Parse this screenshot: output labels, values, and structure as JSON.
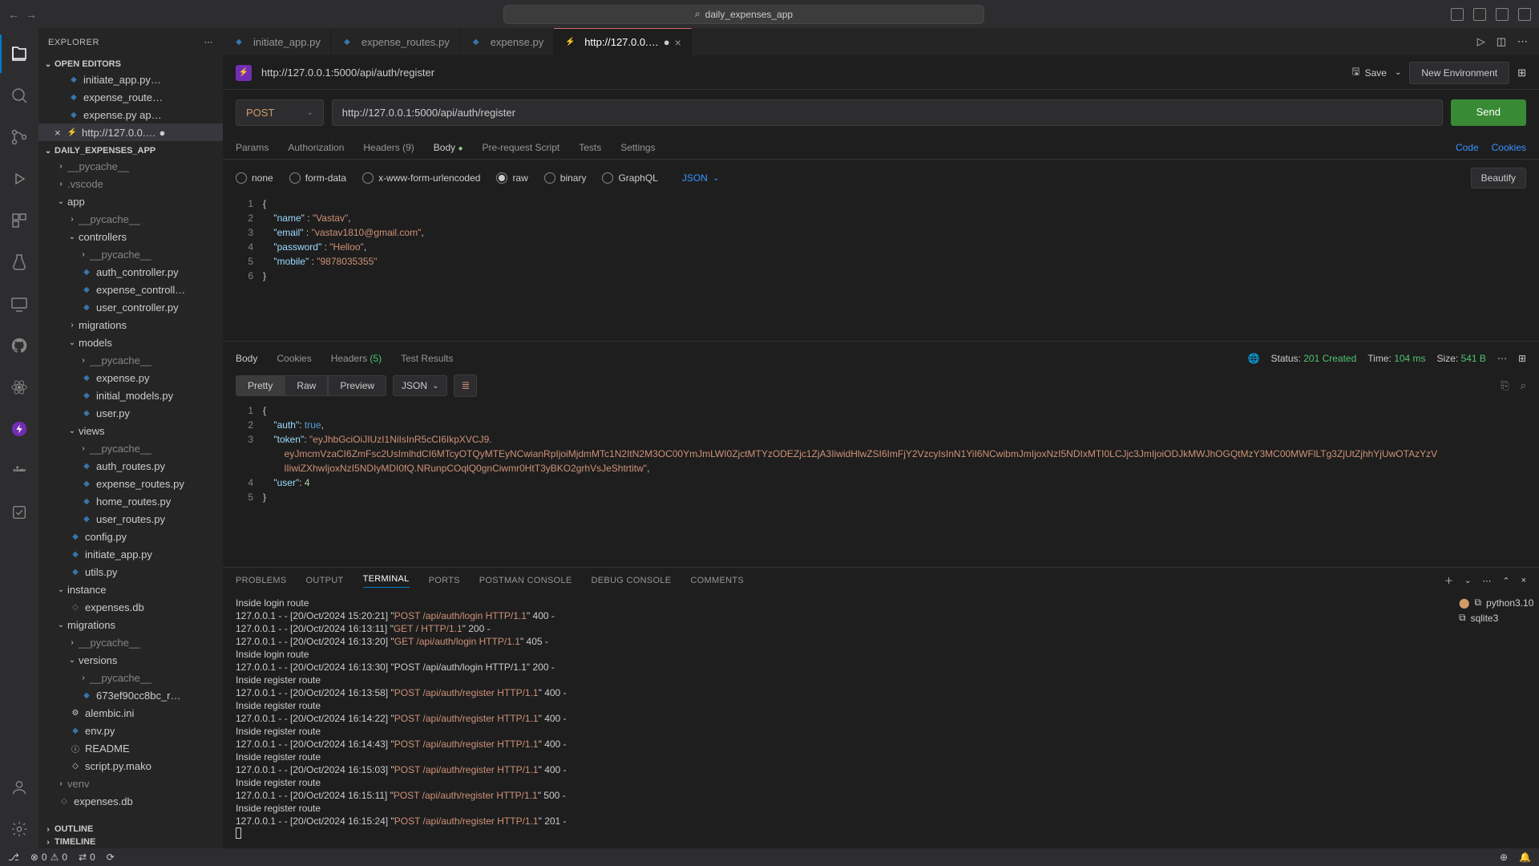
{
  "titlebar": {
    "search_text": "daily_expenses_app"
  },
  "sidebar": {
    "title": "EXPLORER",
    "sections": {
      "open_editors": "OPEN EDITORS",
      "project": "DAILY_EXPENSES_APP",
      "outline": "OUTLINE",
      "timeline": "TIMELINE"
    },
    "open_editors": [
      "initiate_app.py…",
      "expense_route…",
      "expense.py ap…",
      "http://127.0.0.…"
    ],
    "tree": {
      "pycache0": "__pycache__",
      "vscode": ".vscode",
      "app": "app",
      "pycache1": "__pycache__",
      "controllers": "controllers",
      "pycache2": "__pycache__",
      "auth_ctrl": "auth_controller.py",
      "expense_ctrl": "expense_controll…",
      "user_ctrl": "user_controller.py",
      "migrations": "migrations",
      "models": "models",
      "pycache3": "__pycache__",
      "expense": "expense.py",
      "initial_models": "initial_models.py",
      "user": "user.py",
      "views": "views",
      "pycache4": "__pycache__",
      "auth_routes": "auth_routes.py",
      "expense_routes": "expense_routes.py",
      "home_routes": "home_routes.py",
      "user_routes": "user_routes.py",
      "config": "config.py",
      "initiate": "initiate_app.py",
      "utils": "utils.py",
      "instance": "instance",
      "expenses_db": "expenses.db",
      "migrations2": "migrations",
      "pycache5": "__pycache__",
      "versions": "versions",
      "pycache6": "__pycache__",
      "673ef": "673ef90cc8bc_r…",
      "alembic": "alembic.ini",
      "env": "env.py",
      "readme": "README",
      "mako": "script.py.mako",
      "venv": "venv",
      "expenses_db2": "expenses.db"
    }
  },
  "tabs": [
    {
      "label": "initiate_app.py",
      "type": "py",
      "active": false
    },
    {
      "label": "expense_routes.py",
      "type": "py",
      "active": false
    },
    {
      "label": "expense.py",
      "type": "py",
      "active": false
    },
    {
      "label": "http://127.0.0.…",
      "type": "tc",
      "active": true
    }
  ],
  "tc": {
    "url_label": "http://127.0.0.1:5000/api/auth/register",
    "method": "POST",
    "url": "http://127.0.0.1:5000/api/auth/register",
    "send": "Send",
    "save": "Save",
    "new_env": "New Environment",
    "req_tabs": {
      "params": "Params",
      "auth": "Authorization",
      "headers": "Headers",
      "headers_count": "(9)",
      "body": "Body",
      "prescript": "Pre-request Script",
      "tests": "Tests",
      "settings": "Settings",
      "code": "Code",
      "cookies": "Cookies"
    },
    "body_types": {
      "none": "none",
      "form": "form-data",
      "xwww": "x-www-form-urlencoded",
      "raw": "raw",
      "binary": "binary",
      "graphql": "GraphQL"
    },
    "json_label": "JSON",
    "beautify": "Beautify",
    "request_body": {
      "keys": {
        "name": "\"name\"",
        "email": "\"email\"",
        "password": "\"password\"",
        "mobile": "\"mobile\""
      },
      "vals": {
        "name": "\"Vastav\"",
        "email": "\"vastav1810@gmail.com\"",
        "password": "\"Helloo\"",
        "mobile": "\"9878035355\""
      }
    }
  },
  "response": {
    "tabs": {
      "body": "Body",
      "cookies": "Cookies",
      "headers": "Headers",
      "headers_count": "(5)",
      "tests": "Test Results"
    },
    "status_label": "Status:",
    "status_value": "201 Created",
    "time_label": "Time:",
    "time_value": "104 ms",
    "size_label": "Size:",
    "size_value": "541 B",
    "view": {
      "pretty": "Pretty",
      "raw": "Raw",
      "preview": "Preview"
    },
    "fmt": "JSON",
    "body": {
      "auth_key": "\"auth\"",
      "auth_val": "true",
      "token_key": "\"token\"",
      "token_pt1": "\"eyJhbGciOiJIUzI1NiIsInR5cCI6IkpXVCJ9.",
      "token_pt2": "eyJmcmVzaCI6ZmFsc2UsImlhdCI6MTcyOTQyMTEyNCwianRpIjoiMjdmMTc1N2ItN2M3OC00YmJmLWI0ZjctMTYzODEZjc1ZjA3IiwidHlwZSI6ImFjY2VzcyIsInN1YiI6NCwibmJmIjoxNzI5NDIxMTI0LCJjc3JmIjoiODJkMWJhOGQtMzY3MC00MWFlLTg3ZjUtZjhhYjUwOTAzYzV",
      "token_pt3": "lIiwiZXhwIjoxNzI5NDIyMDI0fQ.NRunpCOqlQ0gnCiwmr0HtT3yBKO2grhVsJeShtrtitw\"",
      "user_key": "\"user\"",
      "user_val": "4"
    }
  },
  "panel": {
    "tabs": {
      "problems": "PROBLEMS",
      "output": "OUTPUT",
      "terminal": "TERMINAL",
      "ports": "PORTS",
      "postman": "POSTMAN CONSOLE",
      "debug": "DEBUG CONSOLE",
      "comments": "COMMENTS"
    },
    "procs": {
      "python": "python3.10",
      "sqlite": "sqlite3"
    },
    "lines": [
      {
        "t": "Inside login route"
      },
      {
        "p": "127.0.0.1 - - [20/Oct/2024 15:20:21] \"",
        "h": "POST /api/auth/login HTTP/1.1",
        "s": "\" 400 -"
      },
      {
        "p": "127.0.0.1 - - [20/Oct/2024 16:13:11] \"",
        "h": "GET / HTTP/1.1",
        "s": "\" 200 -"
      },
      {
        "p": "127.0.0.1 - - [20/Oct/2024 16:13:20] \"",
        "h": "GET /api/auth/login HTTP/1.1",
        "s": "\" 405 -"
      },
      {
        "t": "Inside login route"
      },
      {
        "p": "127.0.0.1 - - [20/Oct/2024 16:13:30] \"POST /api/auth/login HTTP/1.1\" 200 -"
      },
      {
        "t": "Inside register route"
      },
      {
        "p": "127.0.0.1 - - [20/Oct/2024 16:13:58] \"",
        "h": "POST /api/auth/register HTTP/1.1",
        "s": "\" 400 -"
      },
      {
        "t": "Inside register route"
      },
      {
        "p": "127.0.0.1 - - [20/Oct/2024 16:14:22] \"",
        "h": "POST /api/auth/register HTTP/1.1",
        "s": "\" 400 -"
      },
      {
        "t": "Inside register route"
      },
      {
        "p": "127.0.0.1 - - [20/Oct/2024 16:14:43] \"",
        "h": "POST /api/auth/register HTTP/1.1",
        "s": "\" 400 -"
      },
      {
        "t": "Inside register route"
      },
      {
        "p": "127.0.0.1 - - [20/Oct/2024 16:15:03] \"",
        "h": "POST /api/auth/register HTTP/1.1",
        "s": "\" 400 -"
      },
      {
        "t": "Inside register route"
      },
      {
        "p": "127.0.0.1 - - [20/Oct/2024 16:15:11] \"",
        "h": "POST /api/auth/register HTTP/1.1",
        "s": "\" 500 -"
      },
      {
        "t": "Inside register route"
      },
      {
        "p": "127.0.0.1 - - [20/Oct/2024 16:15:24] \"",
        "h": "POST /api/auth/register HTTP/1.1",
        "s": "\" 201 -"
      }
    ]
  },
  "statusbar": {
    "errors": "0",
    "warnings": "0",
    "ports": "0"
  }
}
